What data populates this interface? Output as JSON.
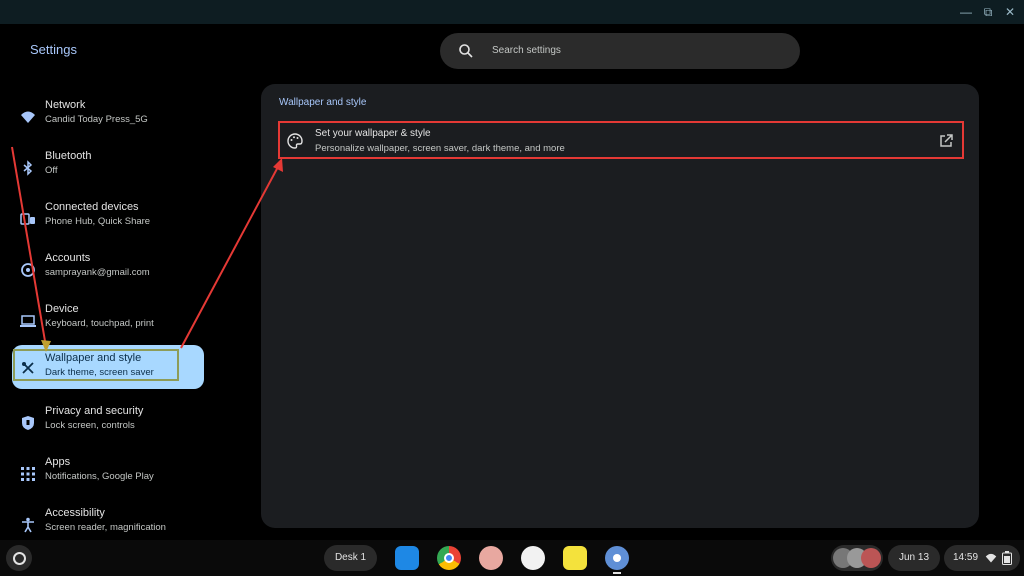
{
  "app": {
    "title": "Settings"
  },
  "window_controls": [
    "minimize-icon",
    "restore-icon",
    "close-icon"
  ],
  "search": {
    "placeholder": "Search settings"
  },
  "sidebar": {
    "items": [
      {
        "label": "Network",
        "sub": "Candid Today Press_5G",
        "icon": "wifi-icon"
      },
      {
        "label": "Bluetooth",
        "sub": "Off",
        "icon": "bluetooth-icon"
      },
      {
        "label": "Connected devices",
        "sub": "Phone Hub, Quick Share",
        "icon": "connected-devices-icon"
      },
      {
        "label": "Accounts",
        "sub": "samprayank@gmail.com",
        "icon": "account-icon"
      },
      {
        "label": "Device",
        "sub": "Keyboard, touchpad, print",
        "icon": "laptop-icon"
      },
      {
        "label": "Wallpaper and style",
        "sub": "Dark theme, screen saver",
        "icon": "brush-icon",
        "active": true
      },
      {
        "label": "Privacy and security",
        "sub": "Lock screen, controls",
        "icon": "shield-icon"
      },
      {
        "label": "Apps",
        "sub": "Notifications, Google Play",
        "icon": "apps-grid-icon"
      },
      {
        "label": "Accessibility",
        "sub": "Screen reader, magnification",
        "icon": "accessibility-icon"
      }
    ]
  },
  "main": {
    "section_title": "Wallpaper and style",
    "row": {
      "title": "Set your wallpaper & style",
      "subtitle": "Personalize wallpaper, screen saver, dark theme, and more",
      "icon": "palette-icon",
      "action_icon": "open-external-icon"
    }
  },
  "shelf": {
    "desk_label": "Desk 1",
    "apps": [
      "files-app",
      "chrome-app",
      "app-3",
      "app-4",
      "app-5",
      "settings-app"
    ],
    "date": "Jun 13",
    "time": "14:59"
  },
  "colors": {
    "accent": "#a8c7fa",
    "active_nav_bg": "#a8d8ff",
    "highlight_red": "#e53935",
    "highlight_olive": "#8d9c58"
  }
}
